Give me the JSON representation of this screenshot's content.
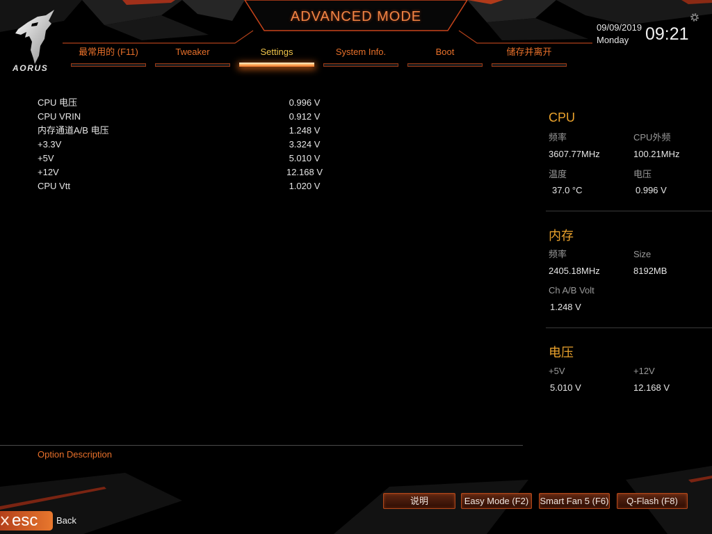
{
  "header": {
    "logo_text": "AORUS",
    "mode_title": "ADVANCED MODE",
    "date": "09/09/2019",
    "weekday": "Monday",
    "time": "09:21"
  },
  "tabs": [
    {
      "label": "最常用的 (F11)",
      "active": false
    },
    {
      "label": "Tweaker",
      "active": false
    },
    {
      "label": "Settings",
      "active": true
    },
    {
      "label": "System Info.",
      "active": false
    },
    {
      "label": "Boot",
      "active": false
    },
    {
      "label": "储存并离开",
      "active": false
    }
  ],
  "voltage_list": [
    {
      "label": "CPU 电压",
      "value": "0.996 V"
    },
    {
      "label": "CPU VRIN",
      "value": "0.912 V"
    },
    {
      "label": "内存通道A/B 电压",
      "value": "1.248 V"
    },
    {
      "label": "+3.3V",
      "value": "3.324 V"
    },
    {
      "label": "+5V",
      "value": "5.010 V"
    },
    {
      "label": "+12V",
      "value": "12.168 V"
    },
    {
      "label": "CPU Vtt",
      "value": "1.020 V"
    }
  ],
  "sidebar": {
    "cpu": {
      "title": "CPU",
      "frequency": {
        "label": "频率",
        "value": "3607.77MHz"
      },
      "bclk": {
        "label": "CPU外频",
        "value": "100.21MHz"
      },
      "temperature": {
        "label": "温度",
        "value": "37.0 °C"
      },
      "voltage": {
        "label": "电压",
        "value": "0.996 V"
      }
    },
    "memory": {
      "title": "内存",
      "frequency": {
        "label": "频率",
        "value": "2405.18MHz"
      },
      "size": {
        "label": "Size",
        "value": "8192MB"
      },
      "voltage": {
        "label": "Ch A/B Volt",
        "value": "1.248 V"
      }
    },
    "voltage": {
      "title": "电压",
      "plus5": {
        "label": "+5V",
        "value": "5.010 V"
      },
      "plus12": {
        "label": "+12V",
        "value": "12.168 V"
      }
    }
  },
  "description": {
    "title": "Option Description"
  },
  "footer": {
    "buttons": [
      {
        "label": "说明"
      },
      {
        "label": "Easy Mode (F2)"
      },
      {
        "label": "Smart Fan 5 (F6)"
      },
      {
        "label": "Q-Flash (F8)"
      }
    ],
    "esc_label": "esc",
    "back_label": "Back"
  },
  "icons": {
    "logo": "aorus-eagle-icon",
    "settings": "gear-icon",
    "esc": "close-icon"
  },
  "colors": {
    "accent": "#e8702a",
    "active": "#f2c54a",
    "title": "#eaa22c",
    "text": "#e6e6e6",
    "muted": "#9a9a9a"
  }
}
